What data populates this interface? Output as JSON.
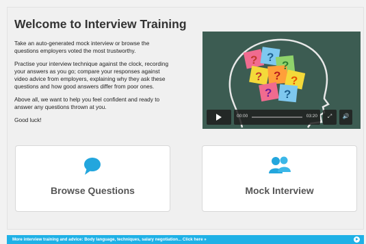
{
  "header": {
    "title": "Welcome to Interview Training"
  },
  "intro": {
    "paragraphs": [
      "Take an auto-generated mock interview or browse the questions employers voted the most trustworthy.",
      "Practise your interview technique against the clock, recording your answers as you go; compare your responses against video advice from employers, explaining why they ask these questions and how good answers differ from poor ones.",
      "Above all, we want to help you feel confident and ready to answer any questions thrown at you.",
      "Good luck!"
    ]
  },
  "video": {
    "current_time": "00:00",
    "duration": "03:20",
    "progress": 0,
    "note_colors": [
      "#f06b8f",
      "#f4d93a",
      "#8fd36b",
      "#ff9f3a",
      "#7ec8ef"
    ],
    "question_mark": "?"
  },
  "cards": {
    "browse": {
      "label": "Browse Questions",
      "icon": "speech-bubble-icon"
    },
    "mock": {
      "label": "Mock Interview",
      "icon": "people-icon"
    }
  },
  "footer": {
    "text": "More interview training and advice: Body language, techniques, salary negotiation... Click here »"
  },
  "colors": {
    "accent": "#1fb1e6",
    "card_label": "#555555"
  }
}
